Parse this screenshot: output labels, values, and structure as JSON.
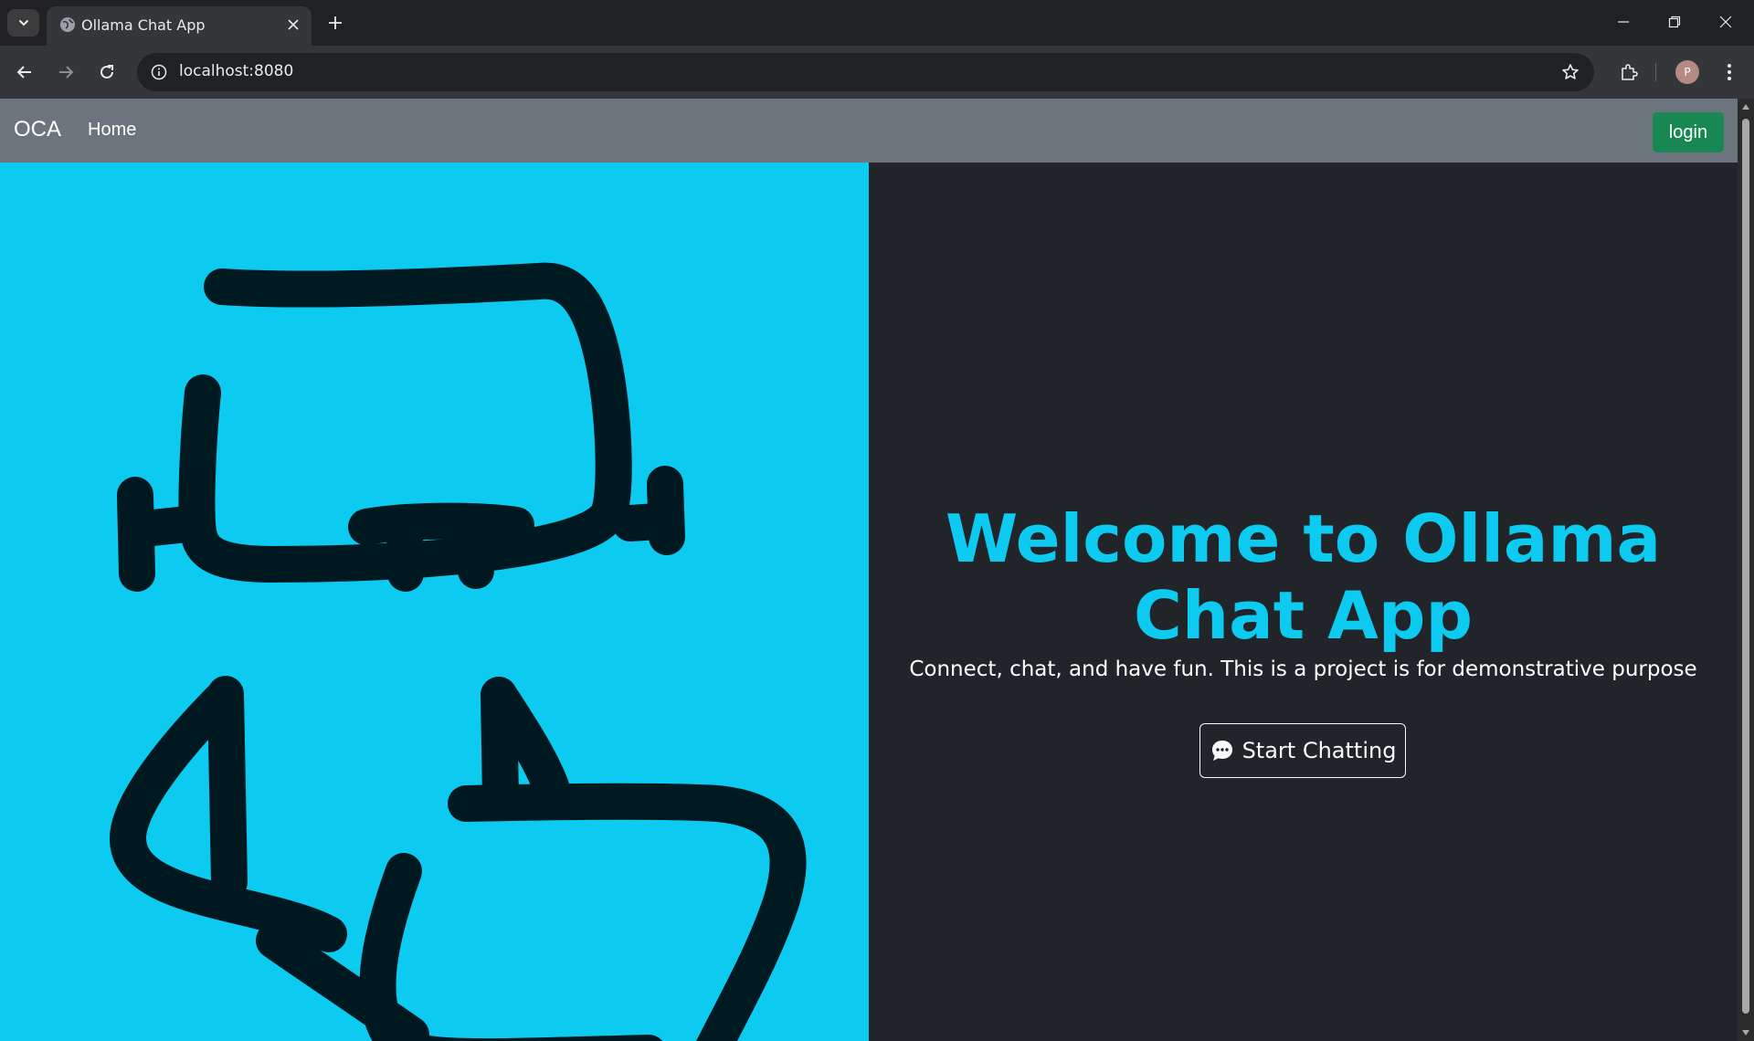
{
  "browser": {
    "tab_title": "Ollama Chat App",
    "url": "localhost:8080",
    "profile_initial": "P",
    "icons": {
      "tab_search": "chevron-down-icon",
      "favicon": "globe-icon",
      "tab_close": "close-icon",
      "new_tab": "plus-icon",
      "back": "arrow-left-icon",
      "forward": "arrow-right-icon",
      "reload": "reload-icon",
      "site_info": "info-icon",
      "bookmark": "star-icon",
      "extensions": "puzzle-icon",
      "menu": "more-vertical-icon",
      "minimize": "minimize-icon",
      "restore": "restore-icon",
      "close_window": "close-icon"
    }
  },
  "navbar": {
    "brand": "OCA",
    "home": "Home",
    "login": "login",
    "background": "#6c757d",
    "login_color": "#198754"
  },
  "hero": {
    "title": "Welcome to Ollama Chat App",
    "subtitle": "Connect, chat, and have fun. This is a project is for demonstrative purpose",
    "cta_label": "Start Chatting",
    "cta_icon": "chat-bubble-icon",
    "accent_color": "#0dcaf0",
    "right_background": "#212529",
    "illustration": "robot-drawing"
  }
}
